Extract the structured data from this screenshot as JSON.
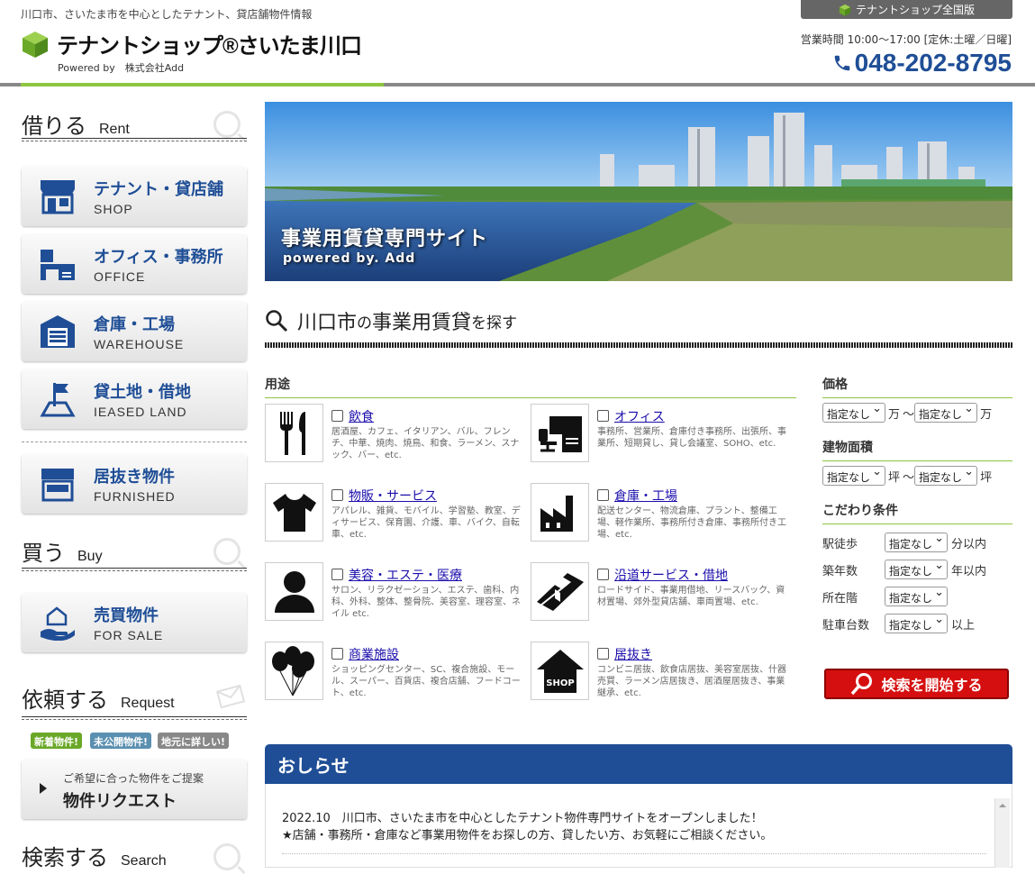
{
  "header": {
    "tagline": "川口市、さいたま市を中心としたテナント、貸店舗物件情報",
    "logo_title": "テナントショップ®さいたま川口",
    "powered_by": "Powered by　株式会社Add",
    "nationwide_label": "テナントショップ全国版",
    "hours": "営業時間 10:00～17:00 [定休:土曜／日曜]",
    "phone": "048-202-8795"
  },
  "sidebar": {
    "rent": {
      "jp": "借りる",
      "en": "Rent"
    },
    "rent_items": [
      {
        "label": "テナント・貸店舗",
        "sub": "SHOP"
      },
      {
        "label": "オフィス・事務所",
        "sub": "OFFICE"
      },
      {
        "label": "倉庫・工場",
        "sub": "WAREHOUSE"
      },
      {
        "label": "貸土地・借地",
        "sub": "IEASED LAND"
      },
      {
        "label": "居抜き物件",
        "sub": "FURNISHED"
      }
    ],
    "buy": {
      "jp": "買う",
      "en": "Buy"
    },
    "buy_item": {
      "label": "売買物件",
      "sub": "FOR SALE"
    },
    "request": {
      "jp": "依頼する",
      "en": "Request"
    },
    "badges": [
      "新着物件!",
      "未公開物件!",
      "地元に詳しい!"
    ],
    "request_btn": {
      "sub": "ご希望に合った物件をご提案",
      "label": "物件リクエスト"
    },
    "search": {
      "jp": "検索する",
      "en": "Search"
    }
  },
  "hero": {
    "title": "事業用賃貸専門サイト",
    "sub": "powered by. Add"
  },
  "search": {
    "heading_a": "川口市",
    "heading_b": "の",
    "heading_c": "事業用賃貸",
    "heading_d": "を探す",
    "use_header": "用途",
    "uses": [
      {
        "label": "飲食",
        "desc": "居酒屋、カフェ、イタリアン、バル、フレンチ、中華、焼肉、焼鳥、和食、ラーメン、スナック、バー、etc."
      },
      {
        "label": "オフィス",
        "desc": "事務所、営業所、倉庫付き事務所、出張所、事業所、短期貸し、貸し会議室、SOHO、etc."
      },
      {
        "label": "物販・サービス",
        "desc": "アパレル、雑貨、モバイル、学習塾、教室、ディサービス、保育園、介護、車、バイク、自転車、etc."
      },
      {
        "label": "倉庫・工場",
        "desc": "配送センター、物流倉庫、プラント、整備工場、軽作業所、事務所付き倉庫、事務所付き工場、etc."
      },
      {
        "label": "美容・エステ・医療",
        "desc": "サロン、リラクゼーション、エステ、歯科、内科、外科、整体、整骨院、美容室、理容室、ネイル etc."
      },
      {
        "label": "沿道サービス・借地",
        "desc": "ロードサイド、事業用借地、リースバック、資材置場、郊外型貸店舗、車両置場、etc."
      },
      {
        "label": "商業施設",
        "desc": "ショッピングセンター、SC、複合施設、モール、スーパー、百貨店、複合店舗、フードコート、etc."
      },
      {
        "label": "居抜き",
        "desc": "コンビニ居抜、飲食店居抜、美容室居抜、什器売買、ラーメン店居抜き、居酒屋居抜き、事業継承、etc."
      }
    ],
    "price_header": "価格",
    "price_unit": "万",
    "tilde": "～",
    "area_header": "建物面積",
    "area_unit": "坪",
    "select_default": "指定なし",
    "cond_header": "こだわり条件",
    "conditions": [
      {
        "label": "駅徒歩",
        "unit": "分以内"
      },
      {
        "label": "築年数",
        "unit": "年以内"
      },
      {
        "label": "所在階",
        "unit": ""
      },
      {
        "label": "駐車台数",
        "unit": "以上"
      }
    ],
    "search_button": "検索を開始する"
  },
  "news": {
    "title": "おしらせ",
    "line1": "2022.10　川口市、さいたま市を中心としたテナント物件専門サイトをオープンしました！",
    "line2": "★店舗・事務所・倉庫など事業用物件をお探しの方、貸したい方、お気軽にご相談ください。"
  }
}
